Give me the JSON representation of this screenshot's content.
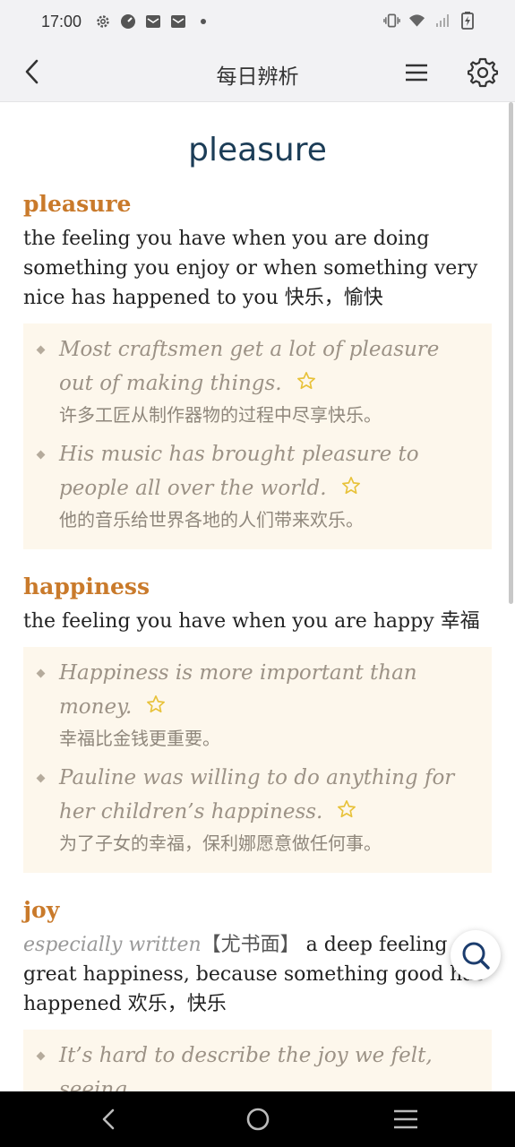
{
  "status": {
    "time": "17:00",
    "left_icons": [
      "gear-icon",
      "timer-icon",
      "mail-icon",
      "mail-icon",
      "dot-icon"
    ],
    "right_icons": [
      "vibrate-icon",
      "wifi-icon",
      "signal-icon",
      "battery-charging-icon"
    ]
  },
  "app_bar": {
    "title": "每日辨析",
    "back_icon": "back-arrow-icon",
    "menu_icon": "menu-icon",
    "settings_icon": "gear-icon"
  },
  "page_title": "pleasure",
  "entries": [
    {
      "headword": "pleasure",
      "definition": "the feeling you have when you are doing something you enjoy or when something very nice has happened to you 快乐，愉快",
      "examples": [
        {
          "en": "Most craftsmen get a lot of pleasure out of making things.",
          "zh": "许多工匠从制作器物的过程中尽享快乐。"
        },
        {
          "en": "His music has brought pleasure to people all over the world.",
          "zh": "他的音乐给世界各地的人们带来欢乐。"
        }
      ]
    },
    {
      "headword": "happiness",
      "definition": "the feeling you have when you are happy 幸福",
      "examples": [
        {
          "en": "Happiness is more important than money.",
          "zh": "幸福比金钱更重要。"
        },
        {
          "en": "Pauline was willing to do anything for her children’s happiness.",
          "zh": "为了子女的幸福，保利娜愿意做任何事。"
        }
      ]
    },
    {
      "headword": "joy",
      "label": "especially written",
      "tag": "【尤书面】",
      "definition": "a deep feeling of great happiness, because something good has happened 欢乐，快乐",
      "examples": [
        {
          "en": "It’s hard to describe the joy we felt, seeing",
          "zh": ""
        }
      ]
    }
  ],
  "colors": {
    "headword": "#c97a2b",
    "title": "#1c3d57",
    "example_bg": "#fdf7ec",
    "star": "#e8c23a"
  }
}
